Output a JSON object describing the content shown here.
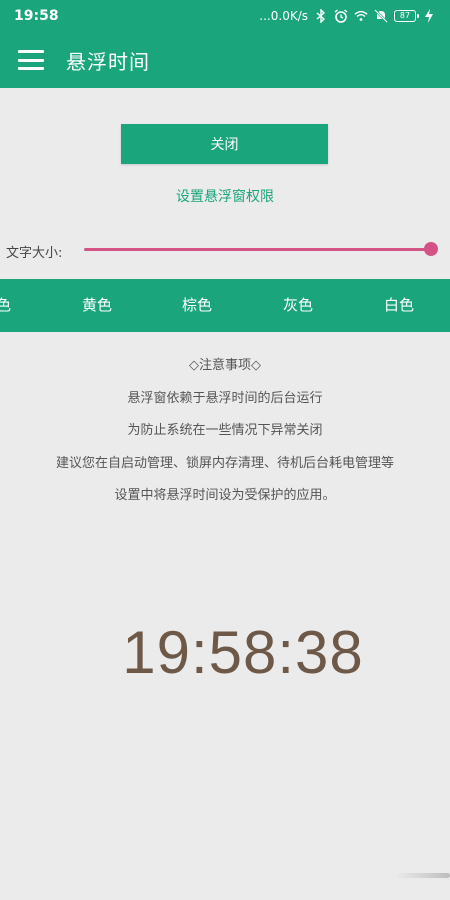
{
  "status_bar": {
    "time": "19:58",
    "network_speed": "...0.0K/s",
    "battery_level": "87",
    "icons": [
      "bluetooth-icon",
      "alarm-icon",
      "wifi-icon",
      "silent-icon",
      "battery-icon",
      "charging-icon"
    ]
  },
  "app_bar": {
    "title": "悬浮时间",
    "menu_icon": "hamburger-menu-icon",
    "color": "#1aa57c"
  },
  "close_button": {
    "label": "关闭"
  },
  "permission_link": {
    "label": "设置悬浮窗权限"
  },
  "font_size": {
    "label": "文字大小:",
    "value": 1.0,
    "color": "#d35387"
  },
  "color_options": [
    {
      "label": "色"
    },
    {
      "label": "黄色"
    },
    {
      "label": "棕色"
    },
    {
      "label": "灰色"
    },
    {
      "label": "白色"
    }
  ],
  "notes": [
    "◇注意事项◇",
    "悬浮窗依赖于悬浮时间的后台运行",
    "为防止系统在一些情况下异常关闭",
    "建议您在自启动管理、锁屏内存清理、待机后台耗电管理等",
    "设置中将悬浮时间设为受保护的应用。"
  ],
  "clock": {
    "time": "19:58:38",
    "color": "#6e5847"
  }
}
